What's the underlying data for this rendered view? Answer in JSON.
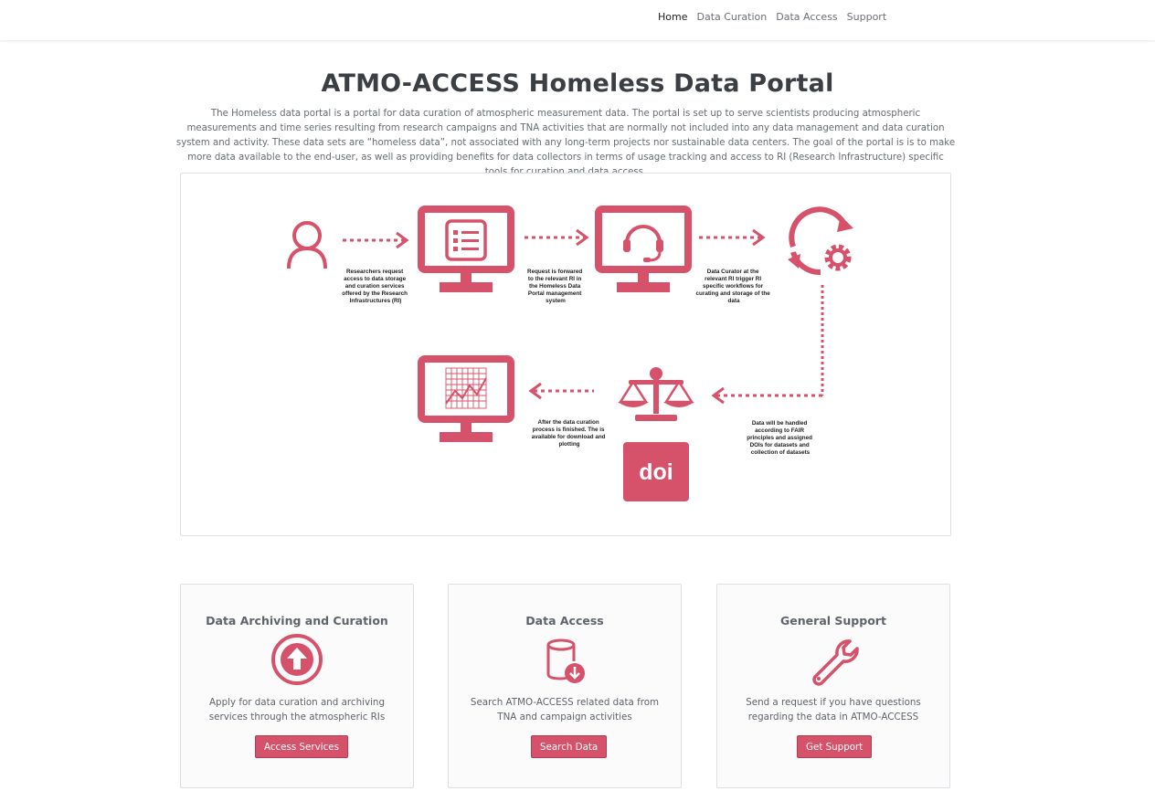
{
  "nav": {
    "items": [
      {
        "label": "Home",
        "active": true
      },
      {
        "label": "Data Curation",
        "active": false
      },
      {
        "label": "Data Access",
        "active": false
      },
      {
        "label": "Support",
        "active": false
      }
    ]
  },
  "hero": {
    "title": "ATMO-ACCESS Homeless Data Portal",
    "description": "The Homeless data portal is a portal for data curation of atmospheric measurement data. The portal is set up to serve scientists producing atmospheric measurements and time series resulting from research campaigns and TNA activities that are normally not included into any data management and data curation system and activity. These data sets are “homeless data”, not associated with any long-term projects nor sustainable data centers. The goal of the portal is is to make more data available to the end-user, as well as providing benefits for data collectors in terms of usage tracking and access to RI (Research Infrastructure) specific tools for curation and data access."
  },
  "diagram": {
    "accent_color": "#d6526a",
    "steps": [
      {
        "icon": "user-icon",
        "caption": [
          "Researchers request",
          "access to data storage",
          "and curation services",
          "offered by the Research",
          "Infrastructures (RI)"
        ]
      },
      {
        "icon": "monitor-list-icon",
        "caption": [
          "Request is forwared",
          "to the relevant RI in",
          "the Homeless Data",
          "Portal management",
          "system"
        ]
      },
      {
        "icon": "monitor-headset-icon",
        "caption": [
          "Data Curator at the",
          "relevant RI trigger RI",
          "specific workflows for",
          "curating and storage of the",
          "data"
        ]
      },
      {
        "icon": "refresh-gear-icon",
        "caption": [
          "Data will be handled",
          "according to FAIR",
          "principles and assigned",
          "DOIs for datasets and",
          "collection of datasets"
        ]
      },
      {
        "icon": "scale-icon",
        "caption": [
          "After the data curation",
          "process is finished. The is",
          "available for download and",
          "plotting"
        ]
      },
      {
        "icon": "doi-icon",
        "label": "doi"
      },
      {
        "icon": "monitor-chart-icon"
      }
    ]
  },
  "cards": [
    {
      "title": "Data Archiving and Curation",
      "icon": "upload-circle-icon",
      "description": "Apply for data curation and archiving services through the atmospheric RIs",
      "button": "Access Services"
    },
    {
      "title": "Data Access",
      "icon": "database-download-icon",
      "description": "Search ATMO-ACCESS related data from TNA and campaign activities",
      "button": "Search Data"
    },
    {
      "title": "General Support",
      "icon": "wrench-icon",
      "description": "Send a request if you have questions regarding the data in ATMO-ACCESS",
      "button": "Get Support"
    }
  ],
  "colors": {
    "accent": "#d6526a",
    "title": "#3b3f44",
    "text": "#5f646a"
  }
}
